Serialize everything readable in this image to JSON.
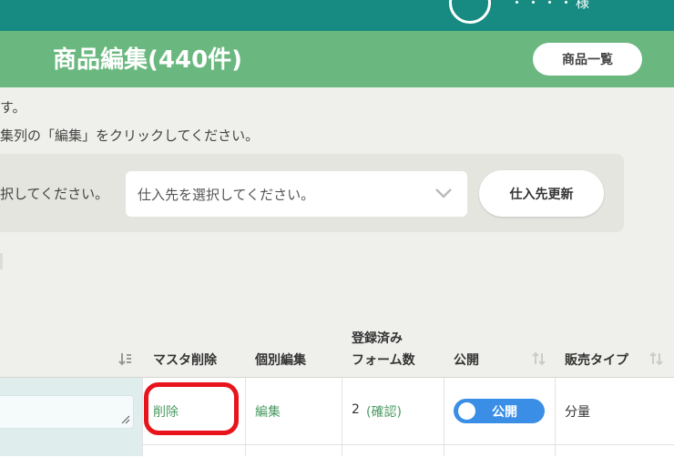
{
  "header": {
    "user_text": "・・・・様"
  },
  "title_bar": {
    "title": "商品編集(440件)",
    "list_button": "商品一覧"
  },
  "description": {
    "line1": "す。",
    "line2": "集列の「編集」をクリックしてください。"
  },
  "supplier": {
    "label": "択してください。",
    "select_placeholder": "仕入先を選択してください。",
    "update_button": "仕入先更新"
  },
  "table": {
    "headers": {
      "master_delete": "マスタ削除",
      "individual_edit": "個別編集",
      "registered_forms_line1": "登録済み",
      "registered_forms_line2": "フォーム数",
      "published": "公開",
      "sales_type": "販売タイプ"
    },
    "rows": [
      {
        "delete_link": "削除",
        "edit_link": "編集",
        "form_count": "2",
        "confirm_link": "(確認)",
        "toggle_label": "公開",
        "sales_type": "分量"
      }
    ]
  },
  "colors": {
    "topbar": "#178b82",
    "titlebar": "#6ab87f",
    "link_green": "#4a9a62",
    "toggle_blue": "#3a8ee6",
    "highlight_red": "#e8141c"
  }
}
